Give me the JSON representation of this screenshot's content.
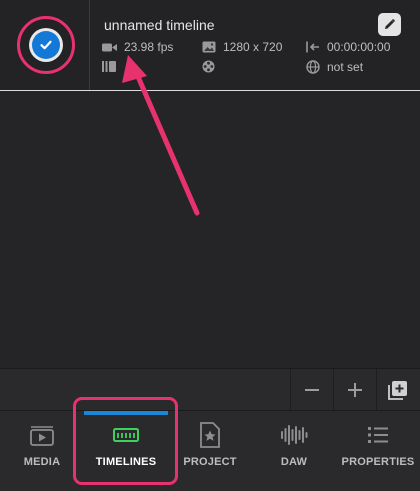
{
  "timeline": {
    "title": "unnamed timeline",
    "fps": "23.98 fps",
    "resolution": "1280 x 720",
    "start_timecode": "00:00:00:00",
    "language": "not set",
    "selected": true
  },
  "icons": {
    "check": "check-icon",
    "edit": "pencil-icon",
    "fps": "video-camera-icon",
    "resolution": "image-icon",
    "timecode": "start-time-icon",
    "tracks": "tracks-icon",
    "reel": "film-reel-icon",
    "language": "globe-icon"
  },
  "toolbar": {
    "zoom_out_icon": "minus-icon",
    "zoom_in_icon": "plus-icon",
    "add_icon": "add-timeline-icon"
  },
  "tabs": [
    {
      "label": "MEDIA",
      "icon": "media-icon",
      "active": false
    },
    {
      "label": "TIMELINES",
      "icon": "timelines-icon",
      "active": true
    },
    {
      "label": "PROJECT",
      "icon": "project-icon",
      "active": false
    },
    {
      "label": "DAW",
      "icon": "waveform-icon",
      "active": false
    },
    {
      "label": "PROPERTIES",
      "icon": "properties-icon",
      "active": false
    }
  ],
  "colors": {
    "accent": "#1478d6",
    "active_tab_icon": "#3dd35b",
    "annotation": "#e8326e",
    "background": "#252528"
  }
}
